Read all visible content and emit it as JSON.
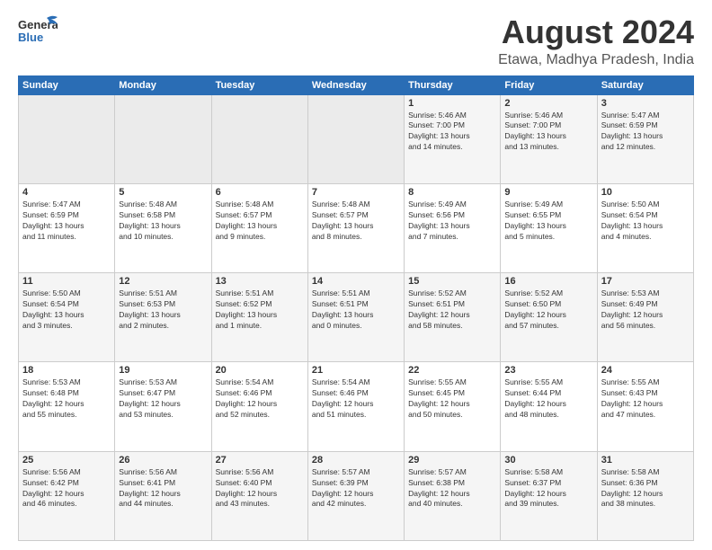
{
  "header": {
    "logo_line1": "General",
    "logo_line2": "Blue",
    "month_title": "August 2024",
    "location": "Etawa, Madhya Pradesh, India"
  },
  "weekdays": [
    "Sunday",
    "Monday",
    "Tuesday",
    "Wednesday",
    "Thursday",
    "Friday",
    "Saturday"
  ],
  "weeks": [
    [
      {
        "day": "",
        "info": ""
      },
      {
        "day": "",
        "info": ""
      },
      {
        "day": "",
        "info": ""
      },
      {
        "day": "",
        "info": ""
      },
      {
        "day": "1",
        "info": "Sunrise: 5:46 AM\nSunset: 7:00 PM\nDaylight: 13 hours\nand 14 minutes."
      },
      {
        "day": "2",
        "info": "Sunrise: 5:46 AM\nSunset: 7:00 PM\nDaylight: 13 hours\nand 13 minutes."
      },
      {
        "day": "3",
        "info": "Sunrise: 5:47 AM\nSunset: 6:59 PM\nDaylight: 13 hours\nand 12 minutes."
      }
    ],
    [
      {
        "day": "4",
        "info": "Sunrise: 5:47 AM\nSunset: 6:59 PM\nDaylight: 13 hours\nand 11 minutes."
      },
      {
        "day": "5",
        "info": "Sunrise: 5:48 AM\nSunset: 6:58 PM\nDaylight: 13 hours\nand 10 minutes."
      },
      {
        "day": "6",
        "info": "Sunrise: 5:48 AM\nSunset: 6:57 PM\nDaylight: 13 hours\nand 9 minutes."
      },
      {
        "day": "7",
        "info": "Sunrise: 5:48 AM\nSunset: 6:57 PM\nDaylight: 13 hours\nand 8 minutes."
      },
      {
        "day": "8",
        "info": "Sunrise: 5:49 AM\nSunset: 6:56 PM\nDaylight: 13 hours\nand 7 minutes."
      },
      {
        "day": "9",
        "info": "Sunrise: 5:49 AM\nSunset: 6:55 PM\nDaylight: 13 hours\nand 5 minutes."
      },
      {
        "day": "10",
        "info": "Sunrise: 5:50 AM\nSunset: 6:54 PM\nDaylight: 13 hours\nand 4 minutes."
      }
    ],
    [
      {
        "day": "11",
        "info": "Sunrise: 5:50 AM\nSunset: 6:54 PM\nDaylight: 13 hours\nand 3 minutes."
      },
      {
        "day": "12",
        "info": "Sunrise: 5:51 AM\nSunset: 6:53 PM\nDaylight: 13 hours\nand 2 minutes."
      },
      {
        "day": "13",
        "info": "Sunrise: 5:51 AM\nSunset: 6:52 PM\nDaylight: 13 hours\nand 1 minute."
      },
      {
        "day": "14",
        "info": "Sunrise: 5:51 AM\nSunset: 6:51 PM\nDaylight: 13 hours\nand 0 minutes."
      },
      {
        "day": "15",
        "info": "Sunrise: 5:52 AM\nSunset: 6:51 PM\nDaylight: 12 hours\nand 58 minutes."
      },
      {
        "day": "16",
        "info": "Sunrise: 5:52 AM\nSunset: 6:50 PM\nDaylight: 12 hours\nand 57 minutes."
      },
      {
        "day": "17",
        "info": "Sunrise: 5:53 AM\nSunset: 6:49 PM\nDaylight: 12 hours\nand 56 minutes."
      }
    ],
    [
      {
        "day": "18",
        "info": "Sunrise: 5:53 AM\nSunset: 6:48 PM\nDaylight: 12 hours\nand 55 minutes."
      },
      {
        "day": "19",
        "info": "Sunrise: 5:53 AM\nSunset: 6:47 PM\nDaylight: 12 hours\nand 53 minutes."
      },
      {
        "day": "20",
        "info": "Sunrise: 5:54 AM\nSunset: 6:46 PM\nDaylight: 12 hours\nand 52 minutes."
      },
      {
        "day": "21",
        "info": "Sunrise: 5:54 AM\nSunset: 6:46 PM\nDaylight: 12 hours\nand 51 minutes."
      },
      {
        "day": "22",
        "info": "Sunrise: 5:55 AM\nSunset: 6:45 PM\nDaylight: 12 hours\nand 50 minutes."
      },
      {
        "day": "23",
        "info": "Sunrise: 5:55 AM\nSunset: 6:44 PM\nDaylight: 12 hours\nand 48 minutes."
      },
      {
        "day": "24",
        "info": "Sunrise: 5:55 AM\nSunset: 6:43 PM\nDaylight: 12 hours\nand 47 minutes."
      }
    ],
    [
      {
        "day": "25",
        "info": "Sunrise: 5:56 AM\nSunset: 6:42 PM\nDaylight: 12 hours\nand 46 minutes."
      },
      {
        "day": "26",
        "info": "Sunrise: 5:56 AM\nSunset: 6:41 PM\nDaylight: 12 hours\nand 44 minutes."
      },
      {
        "day": "27",
        "info": "Sunrise: 5:56 AM\nSunset: 6:40 PM\nDaylight: 12 hours\nand 43 minutes."
      },
      {
        "day": "28",
        "info": "Sunrise: 5:57 AM\nSunset: 6:39 PM\nDaylight: 12 hours\nand 42 minutes."
      },
      {
        "day": "29",
        "info": "Sunrise: 5:57 AM\nSunset: 6:38 PM\nDaylight: 12 hours\nand 40 minutes."
      },
      {
        "day": "30",
        "info": "Sunrise: 5:58 AM\nSunset: 6:37 PM\nDaylight: 12 hours\nand 39 minutes."
      },
      {
        "day": "31",
        "info": "Sunrise: 5:58 AM\nSunset: 6:36 PM\nDaylight: 12 hours\nand 38 minutes."
      }
    ]
  ]
}
